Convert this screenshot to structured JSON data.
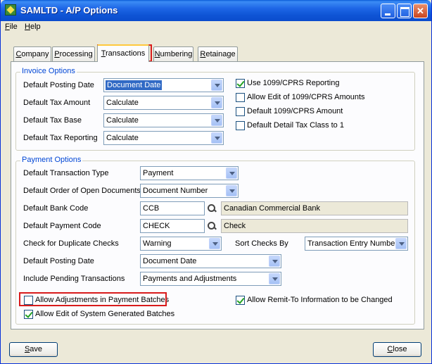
{
  "window": {
    "title": "SAMLTD - A/P Options"
  },
  "menu": [
    {
      "label": "File",
      "accel": "F",
      "rest": "ile"
    },
    {
      "label": "Help",
      "accel": "H",
      "rest": "elp"
    }
  ],
  "tabs": [
    {
      "label": "Company",
      "accel": "C",
      "rest": "ompany"
    },
    {
      "label": "Processing",
      "accel": "P",
      "rest": "rocessing"
    },
    {
      "label": "Transactions",
      "accel": "T",
      "rest": "ransactions",
      "active": true
    },
    {
      "label": "Numbering",
      "accel": "N",
      "rest": "umbering"
    },
    {
      "label": "Retainage",
      "accel": "R",
      "rest": "etainage"
    }
  ],
  "invoice": {
    "title": "Invoice Options",
    "posting_date_label": "Default Posting Date",
    "posting_date_value": "Document Date",
    "tax_amount_label": "Default Tax Amount",
    "tax_amount_value": "Calculate",
    "tax_base_label": "Default Tax Base",
    "tax_base_value": "Calculate",
    "tax_reporting_label": "Default Tax Reporting",
    "tax_reporting_value": "Calculate",
    "use_1099_label": "Use 1099/CPRS Reporting",
    "use_1099_checked": true,
    "allow_edit_1099_label": "Allow Edit of 1099/CPRS Amounts",
    "allow_edit_1099_checked": false,
    "default_1099_label": "Default 1099/CPRS Amount",
    "default_1099_checked": false,
    "detail_tax_label": "Default Detail Tax Class to 1",
    "detail_tax_checked": false
  },
  "payment": {
    "title": "Payment Options",
    "trans_type_label": "Default Transaction Type",
    "trans_type_value": "Payment",
    "order_label": "Default Order of Open Documents",
    "order_value": "Document Number",
    "bank_code_label": "Default Bank Code",
    "bank_code_value": "CCB",
    "bank_code_desc": "Canadian Commercial Bank",
    "payment_code_label": "Default Payment Code",
    "payment_code_value": "CHECK",
    "payment_code_desc": "Check",
    "dup_checks_label": "Check for Duplicate Checks",
    "dup_checks_value": "Warning",
    "sort_checks_label": "Sort Checks By",
    "sort_checks_value": "Transaction Entry Number",
    "posting_date_label": "Default Posting Date",
    "posting_date_value": "Document Date",
    "pending_label": "Include Pending Transactions",
    "pending_value": "Payments and Adjustments",
    "allow_adj_label": "Allow Adjustments in Payment Batches",
    "allow_adj_checked": false,
    "allow_edit_sys_label": "Allow Edit of System Generated Batches",
    "allow_edit_sys_checked": true,
    "allow_remit_label": "Allow Remit-To Information to be Changed",
    "allow_remit_checked": true
  },
  "buttons": {
    "save": {
      "label": "Save",
      "accel": "S",
      "rest": "ave"
    },
    "close": {
      "label": "Close",
      "accel": "C",
      "rest": "lose"
    }
  },
  "colors": {
    "highlight": "#d81b1b",
    "group_title": "#0046d5",
    "title_bar": "#0a4ccd"
  }
}
